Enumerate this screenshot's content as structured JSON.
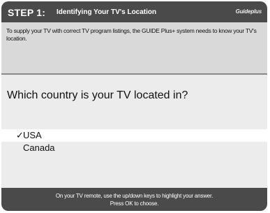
{
  "title_bar": {
    "step": "STEP 1:",
    "title": "Identifying Your TV's Location",
    "logo": "Guideplus"
  },
  "intro": {
    "text": "To supply your TV with correct TV program listings, the GUIDE Plus+ system needs to know your TV's location."
  },
  "question": {
    "text": "Which country is your TV located in?"
  },
  "options": [
    {
      "label": "USA",
      "selected": true,
      "check": "✓"
    },
    {
      "label": "Canada",
      "selected": false,
      "check": ""
    }
  ],
  "footer": {
    "line1": "On your TV remote, use the up/down keys to highlight your answer.",
    "line2": "Press OK to choose."
  }
}
